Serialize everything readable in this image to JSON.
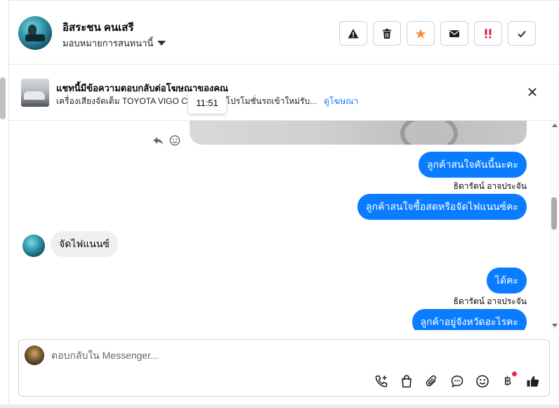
{
  "header": {
    "contact_name": "อิสระชน คนเสรี",
    "assign_label": "มอบหมายการสนทนานี้"
  },
  "actions": [
    {
      "name": "warning-button",
      "icon": "warning-icon"
    },
    {
      "name": "delete-button",
      "icon": "trash-icon"
    },
    {
      "name": "star-button",
      "icon": "star-icon",
      "color": "#f7923b"
    },
    {
      "name": "mail-button",
      "icon": "envelope-icon"
    },
    {
      "name": "priority-button",
      "icon": "exclamation-icon",
      "color": "#e41e3f"
    },
    {
      "name": "done-button",
      "icon": "check-icon"
    }
  ],
  "ad_banner": {
    "title": "แชทนี้มีข้อความตอบกลับต่อโฆษณาของคุณ",
    "description_left": "เครื่องเสียงจัดเต็ม TOYOTA VIGO CH",
    "description_right": "4 โปรโมชั่นรถเข้าใหม่รับ...",
    "link": "ดูโฆษณา"
  },
  "time_tooltip": "11:51",
  "messages": {
    "out_1": "ลูกค้าสนใจคันนี้นะคะ",
    "sender_1": "ธิดารัตน์ อาจประจัน",
    "out_2": "ลูกค้าสนใจซื้อสดหรือจัดไฟแนนซ์คะ",
    "in_1": "จัดไฟแนนซ์",
    "out_3": "ได้คะ",
    "sender_2": "ธิดารัตน์ อาจประจัน",
    "out_4": "ลูกค้าอยู่จังหวัดอะไรคะ"
  },
  "composer": {
    "placeholder": "ตอบกลับใน Messenger...",
    "value": ""
  },
  "colors": {
    "outgoing_bubble": "#0a7cff",
    "incoming_bubble": "#f0f0f0",
    "link": "#1877f2"
  }
}
